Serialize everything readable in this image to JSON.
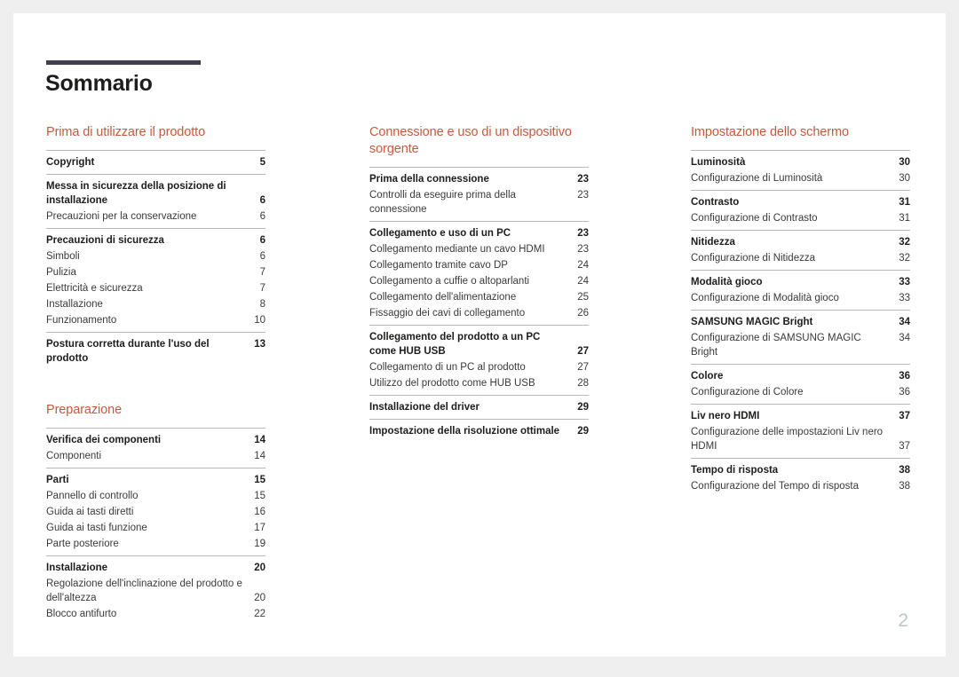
{
  "document": {
    "title": "Sommario",
    "page_number": "2",
    "accent_color": "#c45a3c",
    "rule_color": "#413f4d"
  },
  "columns": [
    {
      "name": "column-1",
      "sections": [
        {
          "title": "Prima di utilizzare il prodotto",
          "groups": [
            {
              "entries": [
                {
                  "type": "main",
                  "label": "Copyright",
                  "page": "5"
                }
              ]
            },
            {
              "entries": [
                {
                  "type": "main",
                  "label": "Messa in sicurezza della posizione di installazione",
                  "page": "6",
                  "wrap": true
                },
                {
                  "type": "sub",
                  "label": "Precauzioni per la conservazione",
                  "page": "6"
                }
              ]
            },
            {
              "entries": [
                {
                  "type": "main",
                  "label": "Precauzioni di sicurezza",
                  "page": "6"
                },
                {
                  "type": "sub",
                  "label": "Simboli",
                  "page": "6"
                },
                {
                  "type": "sub",
                  "label": "Pulizia",
                  "page": "7"
                },
                {
                  "type": "sub",
                  "label": "Elettricità e sicurezza",
                  "page": "7"
                },
                {
                  "type": "sub",
                  "label": "Installazione",
                  "page": "8"
                },
                {
                  "type": "sub",
                  "label": "Funzionamento",
                  "page": "10"
                }
              ]
            },
            {
              "entries": [
                {
                  "type": "main",
                  "label": "Postura corretta durante l'uso del prodotto",
                  "page": "13"
                }
              ]
            }
          ]
        },
        {
          "title": "Preparazione",
          "groups": [
            {
              "entries": [
                {
                  "type": "main",
                  "label": "Verifica dei componenti",
                  "page": "14"
                },
                {
                  "type": "sub",
                  "label": "Componenti",
                  "page": "14"
                }
              ]
            },
            {
              "entries": [
                {
                  "type": "main",
                  "label": "Parti",
                  "page": "15"
                },
                {
                  "type": "sub",
                  "label": "Pannello di controllo",
                  "page": "15"
                },
                {
                  "type": "sub",
                  "label": "Guida ai tasti diretti",
                  "page": "16"
                },
                {
                  "type": "sub",
                  "label": "Guida ai tasti funzione",
                  "page": "17"
                },
                {
                  "type": "sub",
                  "label": "Parte posteriore",
                  "page": "19"
                }
              ]
            },
            {
              "entries": [
                {
                  "type": "main",
                  "label": "Installazione",
                  "page": "20"
                },
                {
                  "type": "sub",
                  "label": "Regolazione dell'inclinazione del prodotto e dell'altezza",
                  "page": "20",
                  "wrap": true
                },
                {
                  "type": "sub",
                  "label": "Blocco antifurto",
                  "page": "22"
                }
              ]
            }
          ]
        }
      ]
    },
    {
      "name": "column-2",
      "sections": [
        {
          "title": "Connessione e uso di un dispositivo sorgente",
          "groups": [
            {
              "entries": [
                {
                  "type": "main",
                  "label": "Prima della connessione",
                  "page": "23"
                },
                {
                  "type": "sub",
                  "label": "Controlli da eseguire prima della connessione",
                  "page": "23"
                }
              ]
            },
            {
              "entries": [
                {
                  "type": "main",
                  "label": "Collegamento e uso di un PC",
                  "page": "23"
                },
                {
                  "type": "sub",
                  "label": "Collegamento mediante un cavo HDMI",
                  "page": "23"
                },
                {
                  "type": "sub",
                  "label": "Collegamento tramite cavo DP",
                  "page": "24"
                },
                {
                  "type": "sub",
                  "label": "Collegamento a cuffie o altoparlanti",
                  "page": "24"
                },
                {
                  "type": "sub",
                  "label": "Collegamento dell'alimentazione",
                  "page": "25"
                },
                {
                  "type": "sub",
                  "label": "Fissaggio dei cavi di collegamento",
                  "page": "26"
                }
              ]
            },
            {
              "entries": [
                {
                  "type": "main",
                  "label": "Collegamento del prodotto a un PC come HUB USB",
                  "page": "27",
                  "wrap": true
                },
                {
                  "type": "sub",
                  "label": "Collegamento di un PC al prodotto",
                  "page": "27"
                },
                {
                  "type": "sub",
                  "label": "Utilizzo del prodotto come HUB USB",
                  "page": "28"
                }
              ]
            },
            {
              "entries": [
                {
                  "type": "main",
                  "label": "Installazione del driver",
                  "page": "29"
                }
              ]
            },
            {
              "entries": [
                {
                  "type": "main",
                  "label": "Impostazione della risoluzione ottimale",
                  "page": "29"
                }
              ]
            }
          ]
        }
      ]
    },
    {
      "name": "column-3",
      "sections": [
        {
          "title": "Impostazione dello schermo",
          "groups": [
            {
              "entries": [
                {
                  "type": "main",
                  "label": "Luminosità",
                  "page": "30"
                },
                {
                  "type": "sub",
                  "label": "Configurazione di Luminosità",
                  "page": "30"
                }
              ]
            },
            {
              "entries": [
                {
                  "type": "main",
                  "label": "Contrasto",
                  "page": "31"
                },
                {
                  "type": "sub",
                  "label": "Configurazione di Contrasto",
                  "page": "31"
                }
              ]
            },
            {
              "entries": [
                {
                  "type": "main",
                  "label": "Nitidezza",
                  "page": "32"
                },
                {
                  "type": "sub",
                  "label": "Configurazione di Nitidezza",
                  "page": "32"
                }
              ]
            },
            {
              "entries": [
                {
                  "type": "main",
                  "label": "Modalità gioco",
                  "page": "33"
                },
                {
                  "type": "sub",
                  "label": "Configurazione di Modalità gioco",
                  "page": "33"
                }
              ]
            },
            {
              "entries": [
                {
                  "type": "main",
                  "label": "SAMSUNG MAGIC Bright",
                  "page": "34"
                },
                {
                  "type": "sub",
                  "label": "Configurazione di SAMSUNG MAGIC Bright",
                  "page": "34"
                }
              ]
            },
            {
              "entries": [
                {
                  "type": "main",
                  "label": "Colore",
                  "page": "36"
                },
                {
                  "type": "sub",
                  "label": "Configurazione di Colore",
                  "page": "36"
                }
              ]
            },
            {
              "entries": [
                {
                  "type": "main",
                  "label": "Liv nero HDMI",
                  "page": "37"
                },
                {
                  "type": "sub",
                  "label": "Configurazione delle impostazioni Liv nero HDMI",
                  "page": "37",
                  "wrap": true
                }
              ]
            },
            {
              "entries": [
                {
                  "type": "main",
                  "label": "Tempo di risposta",
                  "page": "38"
                },
                {
                  "type": "sub",
                  "label": "Configurazione del Tempo di risposta",
                  "page": "38"
                }
              ]
            }
          ]
        }
      ]
    }
  ]
}
